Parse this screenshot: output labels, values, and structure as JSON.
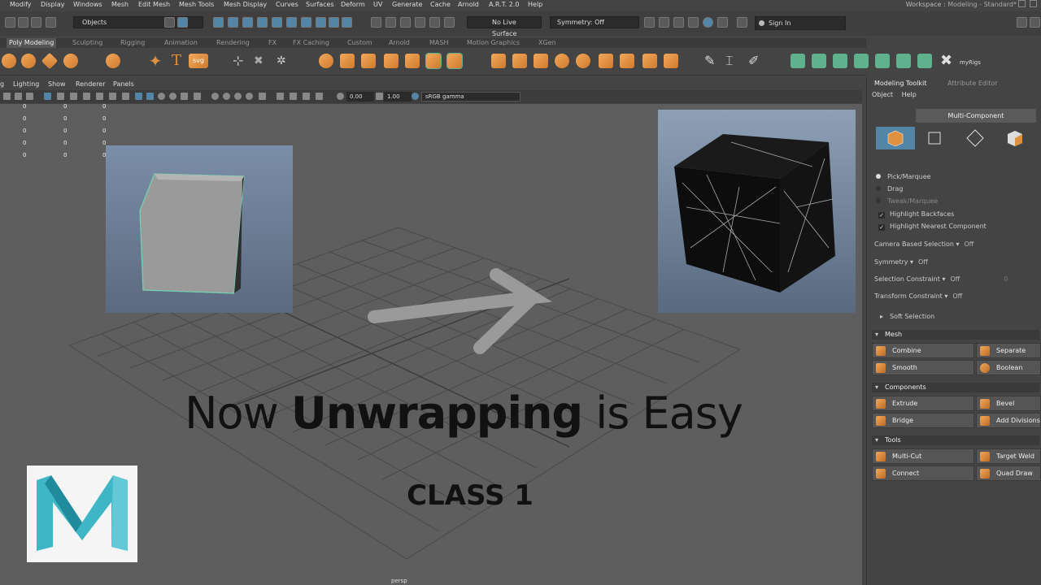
{
  "menubar": {
    "items": [
      "Modify",
      "Display",
      "Windows",
      "Mesh",
      "Edit Mesh",
      "Mesh Tools",
      "Mesh Display",
      "Curves",
      "Surfaces",
      "Deform",
      "UV",
      "Generate",
      "Cache",
      "Arnold",
      "A.R.T. 2.0",
      "Help"
    ],
    "workspace_label": "Workspace :",
    "workspace_value": "Modeling - Standard*"
  },
  "statusline": {
    "objects": "Objects",
    "live_surface": "No Live Surface",
    "symmetry": "Symmetry: Off",
    "sign_in": "Sign In"
  },
  "shelf_tabs": [
    "Poly Modeling",
    "Sculpting",
    "Rigging",
    "Animation",
    "Rendering",
    "FX",
    "FX Caching",
    "Custom",
    "Arnold",
    "MASH",
    "Motion Graphics",
    "XGen"
  ],
  "shelf_icons": [
    "sphere-icon",
    "torus-icon",
    "cube-icon",
    "cylinder-icon",
    "platonic-icon",
    "star-icon",
    "text-icon",
    "svg-icon",
    "pivot-icon",
    "scale-icon",
    "snap-icon",
    "combine-icon",
    "separate-icon",
    "smooth-icon",
    "extrude-icon",
    "bevel-icon",
    "bridge-icon",
    "multicut-icon",
    "target-weld-icon",
    "quad-draw-icon",
    "uv-editor-icon",
    "myrigs-icon"
  ],
  "shelf_svg_label": "svg",
  "shelf_text_label": "T",
  "shelf_myrigs_label": "myRigs",
  "panel_menu": [
    "g",
    "Lighting",
    "Show",
    "Renderer",
    "Panels"
  ],
  "panel_tools": {
    "exposure": "0.00",
    "gamma_value": "1.00",
    "color_space": "sRGB gamma"
  },
  "hud": {
    "rows": [
      [
        "0",
        "0",
        "0"
      ],
      [
        "0",
        "0",
        "0"
      ],
      [
        "0",
        "0",
        "0"
      ],
      [
        "0",
        "0",
        "0"
      ],
      [
        "0",
        "0",
        "0"
      ]
    ]
  },
  "overlay": {
    "title_pre": "Now ",
    "title_bold": "Unwrapping",
    "title_post": " is Easy",
    "subtitle": "CLASS 1",
    "logo_letter": "M"
  },
  "viewport_label": "persp",
  "right_panel": {
    "tabs": [
      "Modeling Toolkit",
      "Attribute Editor"
    ],
    "menu": [
      "Object",
      "Help"
    ],
    "multi_component": "Multi-Component",
    "selection_modes": [
      {
        "label": "Pick/Marquee",
        "on": true,
        "dim": false
      },
      {
        "label": "Drag",
        "on": false,
        "dim": false
      },
      {
        "label": "Tweak/Marquee",
        "on": false,
        "dim": true
      }
    ],
    "checks": [
      "Highlight Backfaces",
      "Highlight Nearest Component"
    ],
    "props": [
      {
        "label": "Camera Based Selection",
        "value": "Off"
      },
      {
        "label": "Symmetry",
        "value": "Off"
      },
      {
        "label": "Selection Constraint",
        "value": "Off",
        "extra": "0"
      },
      {
        "label": "Transform Constraint",
        "value": "Off"
      }
    ],
    "soft_selection": "Soft Selection",
    "sections": {
      "mesh": {
        "title": "Mesh",
        "buttons": [
          "Combine",
          "Separate",
          "Smooth",
          "Boolean"
        ]
      },
      "components": {
        "title": "Components",
        "buttons": [
          "Extrude",
          "Bevel",
          "Bridge",
          "Add Divisions"
        ]
      },
      "tools": {
        "title": "Tools",
        "buttons": [
          "Multi-Cut",
          "Target Weld",
          "Connect",
          "Quad Draw"
        ]
      }
    }
  },
  "colors": {
    "accent": "#5285a6",
    "orange": "#e0913f",
    "viewport": "#5e5e5e"
  }
}
